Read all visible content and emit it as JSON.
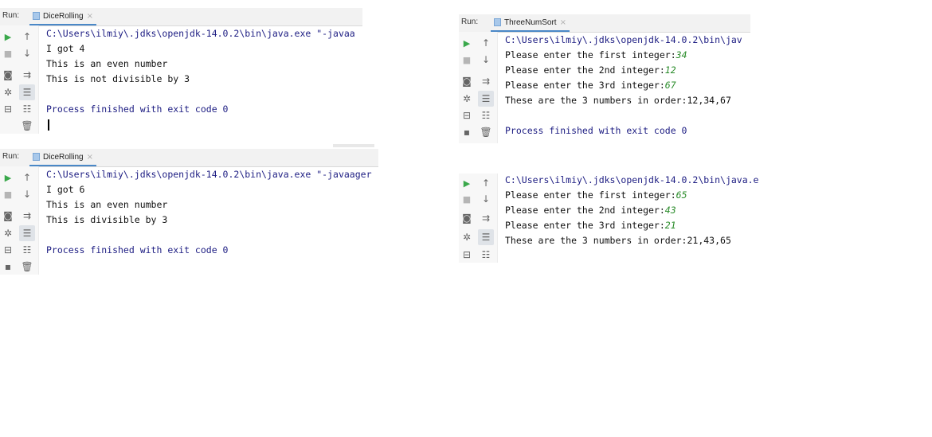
{
  "run_label": "Run:",
  "panel1": {
    "tab": "DiceRolling",
    "close": "×",
    "path": "C:\\Users\\ilmiy\\.jdks\\openjdk-14.0.2\\bin\\java.exe \"-javaa",
    "l1": "I got 4",
    "l2": "This is an even number",
    "l3": "This is not divisible by 3",
    "exit": "Process finished with exit code 0"
  },
  "panel2": {
    "tab": "DiceRolling",
    "close": "×",
    "path": "C:\\Users\\ilmiy\\.jdks\\openjdk-14.0.2\\bin\\java.exe \"-javaager",
    "l1": "I got 6",
    "l2": "This is an even number",
    "l3": "This is divisible by 3",
    "exit": "Process finished with exit code 0"
  },
  "panel3": {
    "tab": "ThreeNumSort",
    "close": "×",
    "path": "C:\\Users\\ilmiy\\.jdks\\openjdk-14.0.2\\bin\\jav",
    "p1": "Please enter the first integer:",
    "v1": "34",
    "p2": "Please enter the 2nd integer:",
    "v2": "12",
    "p3": "Please enter the 3rd integer:",
    "v3": "67",
    "result": "These are the 3 numbers in order:12,34,67",
    "exit": "Process finished with exit code 0"
  },
  "panel4": {
    "path": "C:\\Users\\ilmiy\\.jdks\\openjdk-14.0.2\\bin\\java.e",
    "p1": "Please enter the first integer:",
    "v1": "65",
    "p2": "Please enter the 2nd integer:",
    "v2": "43",
    "p3": "Please enter the 3rd integer:",
    "v3": "21",
    "result": "These are the 3 numbers in order:21,43,65"
  },
  "icons": {
    "run": "▶",
    "stop": "■",
    "up": "↑",
    "down": "↓",
    "camera": "◙",
    "wrap": "⇉",
    "bug": "✲",
    "scroll": "☰",
    "exit": "⊟",
    "print": "☷",
    "trash": "🗑",
    "pin": "▪"
  },
  "colors": {
    "tab_underline": "#4a88c7",
    "user_input": "#2a8c2a",
    "path_text": "#1c1c82",
    "run_green": "#3aa84b"
  }
}
